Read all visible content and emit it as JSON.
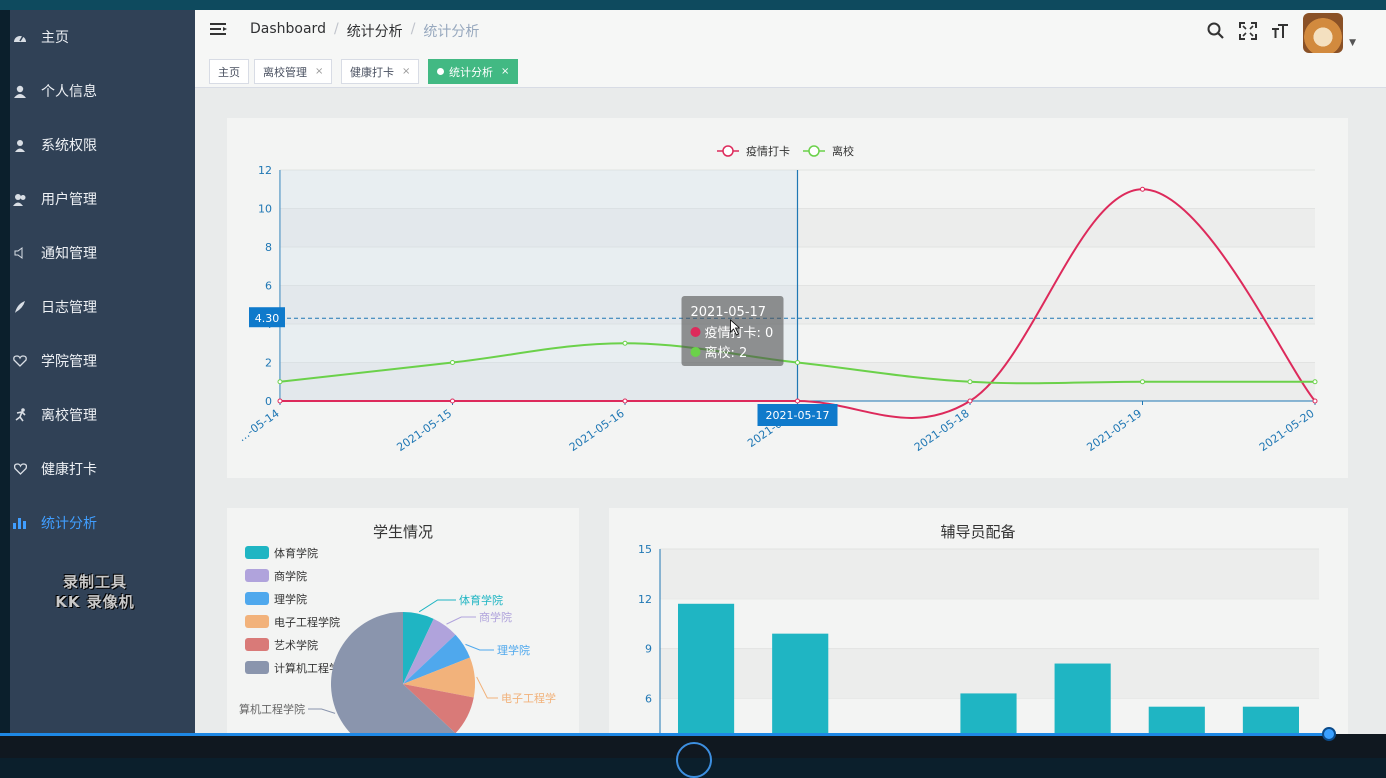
{
  "sidebar": {
    "items": [
      {
        "label": "主页",
        "icon": "dashboard-icon"
      },
      {
        "label": "个人信息",
        "icon": "user-icon"
      },
      {
        "label": "系统权限",
        "icon": "permission-icon"
      },
      {
        "label": "用户管理",
        "icon": "users-icon"
      },
      {
        "label": "通知管理",
        "icon": "speaker-icon"
      },
      {
        "label": "日志管理",
        "icon": "feather-icon"
      },
      {
        "label": "学院管理",
        "icon": "shield-heart-icon"
      },
      {
        "label": "离校管理",
        "icon": "running-icon"
      },
      {
        "label": "健康打卡",
        "icon": "heart-icon"
      },
      {
        "label": "统计分析",
        "icon": "bar-chart-icon"
      }
    ],
    "active_index": 9,
    "active_color": "#409eff"
  },
  "watermark": {
    "line1": "录制工具",
    "line2": "KK 录像机"
  },
  "breadcrumb": {
    "item1": "Dashboard",
    "item2": "统计分析",
    "item3": "统计分析"
  },
  "tags": [
    {
      "label": "主页",
      "closable": false,
      "active": false
    },
    {
      "label": "离校管理",
      "closable": true,
      "active": false
    },
    {
      "label": "健康打卡",
      "closable": true,
      "active": false
    },
    {
      "label": "统计分析",
      "closable": true,
      "active": true
    }
  ],
  "tag_close_glyph": "×",
  "chart_data": [
    {
      "type": "line",
      "x": [
        "2021-05-14",
        "2021-05-15",
        "2021-05-16",
        "2021-05-17",
        "2021-05-18",
        "2021-05-19",
        "2021-05-20"
      ],
      "x_tick_labels": [
        "…-05-14",
        "2021-05-15",
        "2021-05-16",
        "2021-05…",
        "2021-05-18",
        "2021-05-19",
        "2021-05-20"
      ],
      "series": [
        {
          "name": "疫情打卡",
          "values": [
            0,
            0,
            0,
            0,
            0,
            11,
            0
          ],
          "color": "#dd2a5b"
        },
        {
          "name": "离校",
          "values": [
            1,
            2,
            3,
            2,
            1,
            1,
            1
          ],
          "color": "#6bd14a"
        }
      ],
      "ylim": [
        0,
        12
      ],
      "yticks": [
        0,
        2,
        4,
        6,
        8,
        10,
        12
      ],
      "legend_position": "top-center",
      "grid": true,
      "smooth": true,
      "crosshair": {
        "x": "2021-05-17",
        "y": 4.3,
        "y_label": "4.30",
        "x_label": "2021-05-17"
      },
      "tooltip": {
        "title": "2021-05-17",
        "line1": "疫情打卡: 0",
        "line2": "离校: 2"
      }
    },
    {
      "type": "pie",
      "title": "学生情况",
      "legend_position": "top-left",
      "slices": [
        {
          "label": "体育学院",
          "value": 7,
          "color": "#1fb5c3"
        },
        {
          "label": "商学院",
          "value": 6,
          "color": "#b0a3dc"
        },
        {
          "label": "理学院",
          "value": 6,
          "color": "#4fa8ed"
        },
        {
          "label": "电子工程学院",
          "value": 9,
          "color": "#f2b27b"
        },
        {
          "label": "艺术学院",
          "value": 9,
          "color": "#d97a78"
        },
        {
          "label": "计算机工程学院",
          "value": 63,
          "color": "#8a95ad"
        }
      ],
      "slice_labels_shown": [
        "体育学院",
        "商学院",
        "理学院",
        "电子工程学",
        "算机工程学院"
      ]
    },
    {
      "type": "bar",
      "title": "辅导员配备",
      "values": [
        11.7,
        9.9,
        0,
        6.3,
        8.1,
        5.5,
        5.5
      ],
      "color": "#1fb5c3",
      "ylim": [
        0,
        15
      ],
      "yticks_visible": [
        6,
        9,
        12,
        15
      ],
      "grid": true
    }
  ]
}
